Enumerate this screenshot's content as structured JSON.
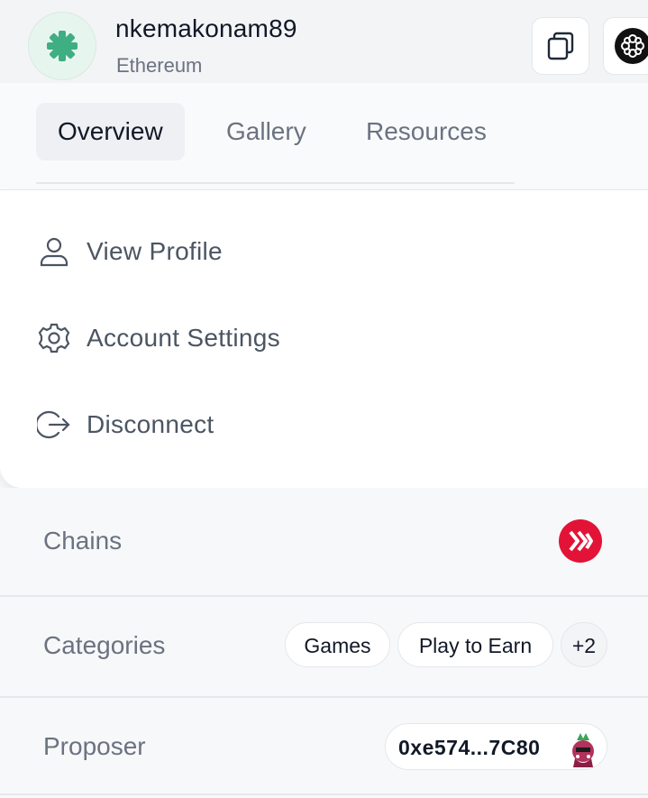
{
  "account": {
    "username": "nkemakonam89",
    "network": "Ethereum",
    "avatar_icon": "gear-avatar-icon",
    "avatar_color": "#3fae83"
  },
  "tabs": [
    {
      "label": "Overview",
      "active": true
    },
    {
      "label": "Gallery",
      "active": false
    },
    {
      "label": "Resources",
      "active": false
    }
  ],
  "menu": {
    "items": [
      {
        "label": "View Profile",
        "icon": "user-icon"
      },
      {
        "label": "Account Settings",
        "icon": "gear-icon"
      },
      {
        "label": "Disconnect",
        "icon": "logout-icon"
      }
    ]
  },
  "details": {
    "chains_label": "Chains",
    "chain_logo": "hive-chain-icon",
    "chain_color": "#e31337",
    "categories_label": "Categories",
    "categories": [
      "Games",
      "Play to Earn"
    ],
    "categories_more": "+2",
    "proposer_label": "Proposer",
    "proposer_address": "0xe574...7C80"
  }
}
